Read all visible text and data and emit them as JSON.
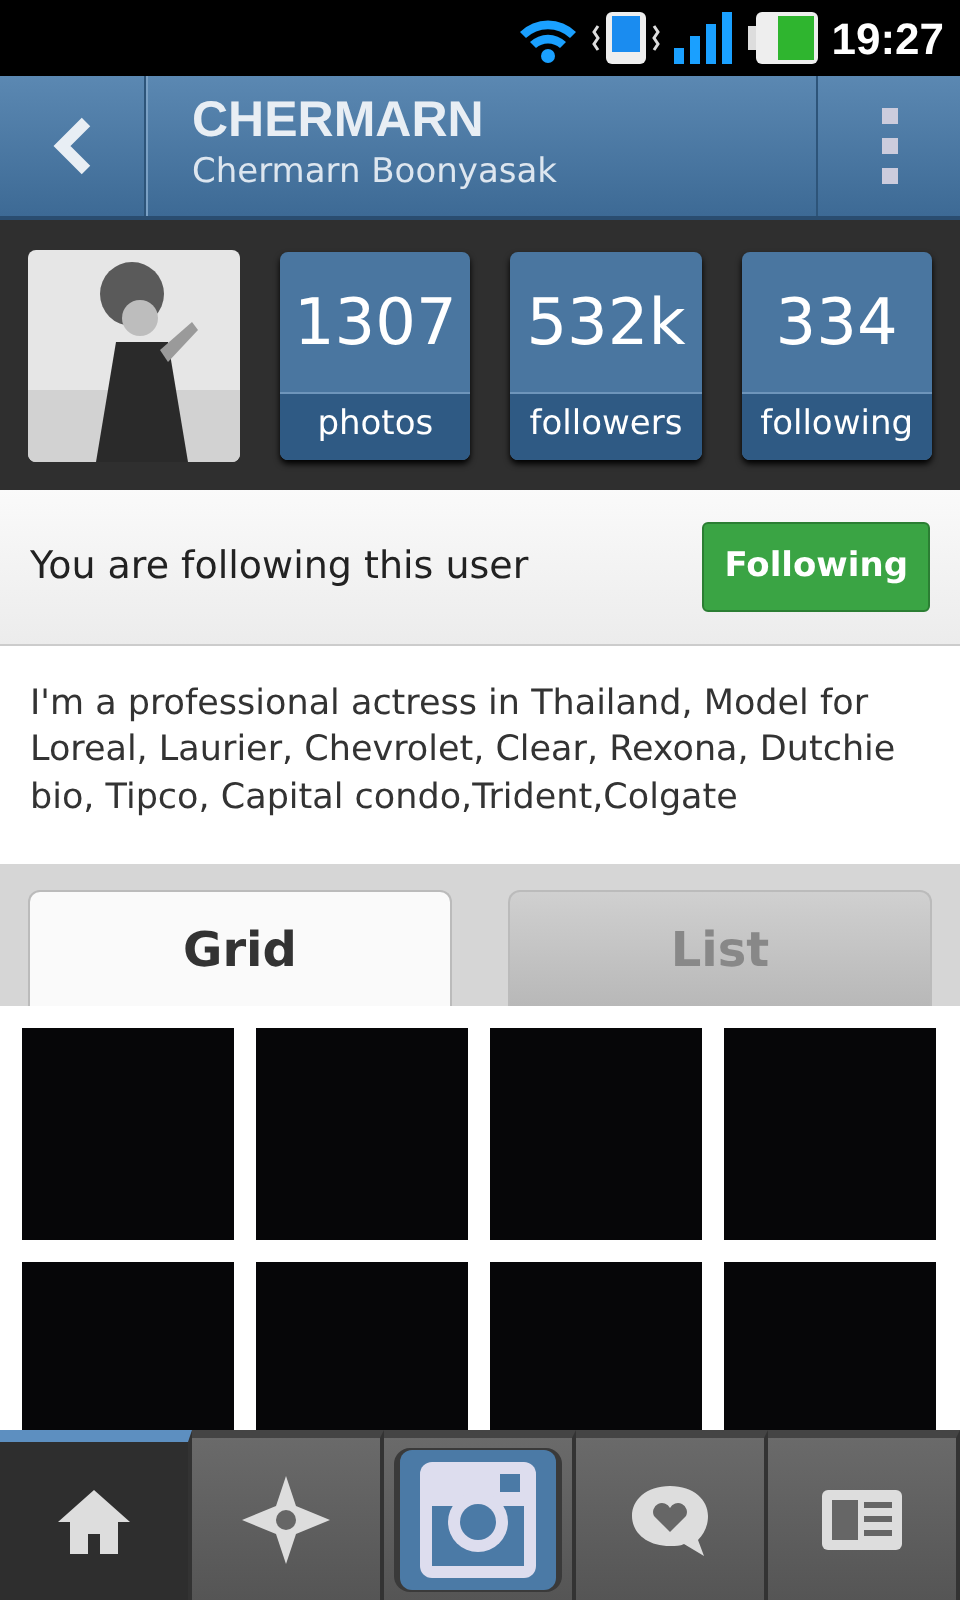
{
  "status_bar": {
    "time": "19:27"
  },
  "header": {
    "username": "CHERMARN",
    "full_name": "Chermarn Boonyasak"
  },
  "profile": {
    "stats": [
      {
        "value": "1307",
        "label": "photos"
      },
      {
        "value": "532k",
        "label": "followers"
      },
      {
        "value": "334",
        "label": "following"
      }
    ]
  },
  "follow": {
    "message": "You are following this user",
    "button": "Following"
  },
  "bio": "I'm a professional actress in Thailand, Model for Loreal, Laurier, Chevrolet, Clear, Rexona, Dutchie bio, Tipco, Capital condo,Trident,Colgate",
  "tabs": [
    {
      "label": "Grid",
      "selected": true
    },
    {
      "label": "List",
      "selected": false
    }
  ],
  "grid": [
    {
      "kind": "blank"
    },
    {
      "kind": "blank"
    },
    {
      "kind": "blank"
    },
    {
      "kind": "blank"
    },
    {
      "kind": "blank"
    },
    {
      "kind": "blank"
    },
    {
      "kind": "blank"
    },
    {
      "kind": "blank"
    }
  ],
  "bottom_nav": [
    {
      "kind": "home",
      "selected": true
    },
    {
      "kind": "explore",
      "selected": false
    },
    {
      "kind": "camera",
      "selected": false
    },
    {
      "kind": "activity",
      "selected": false
    },
    {
      "kind": "profile",
      "selected": false
    }
  ]
}
